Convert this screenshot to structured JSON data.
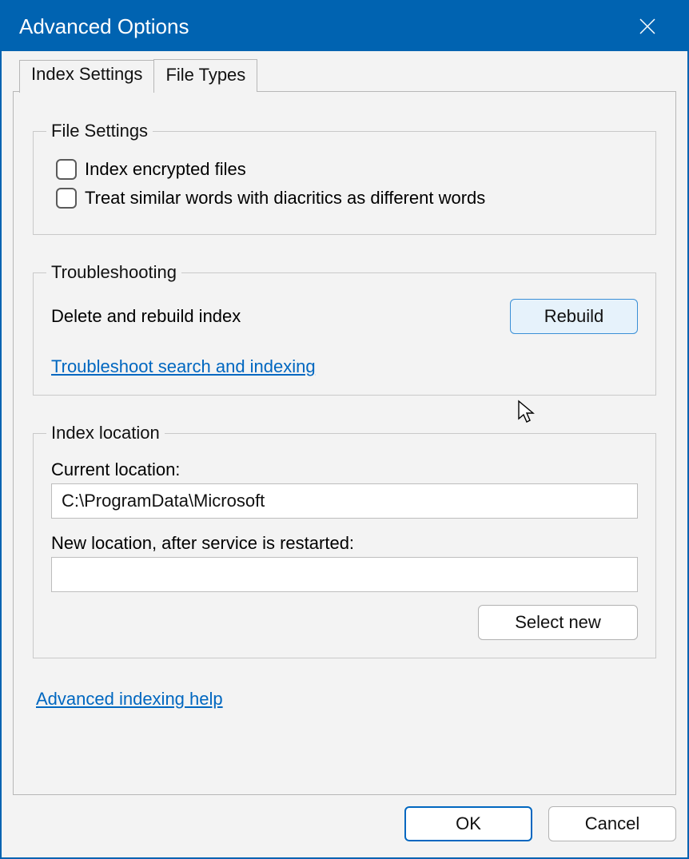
{
  "window": {
    "title": "Advanced Options"
  },
  "tabs": {
    "index_settings": "Index Settings",
    "file_types": "File Types"
  },
  "file_settings": {
    "legend": "File Settings",
    "index_encrypted": "Index encrypted files",
    "diacritics": "Treat similar words with diacritics as different words"
  },
  "troubleshooting": {
    "legend": "Troubleshooting",
    "delete_rebuild_label": "Delete and rebuild index",
    "rebuild_button": "Rebuild",
    "troubleshoot_link": "Troubleshoot search and indexing"
  },
  "index_location": {
    "legend": "Index location",
    "current_label": "Current location:",
    "current_value": "C:\\ProgramData\\Microsoft",
    "new_label": "New location, after service is restarted:",
    "new_value": "",
    "select_new_button": "Select new"
  },
  "links": {
    "advanced_help": "Advanced indexing help"
  },
  "buttons": {
    "ok": "OK",
    "cancel": "Cancel"
  }
}
